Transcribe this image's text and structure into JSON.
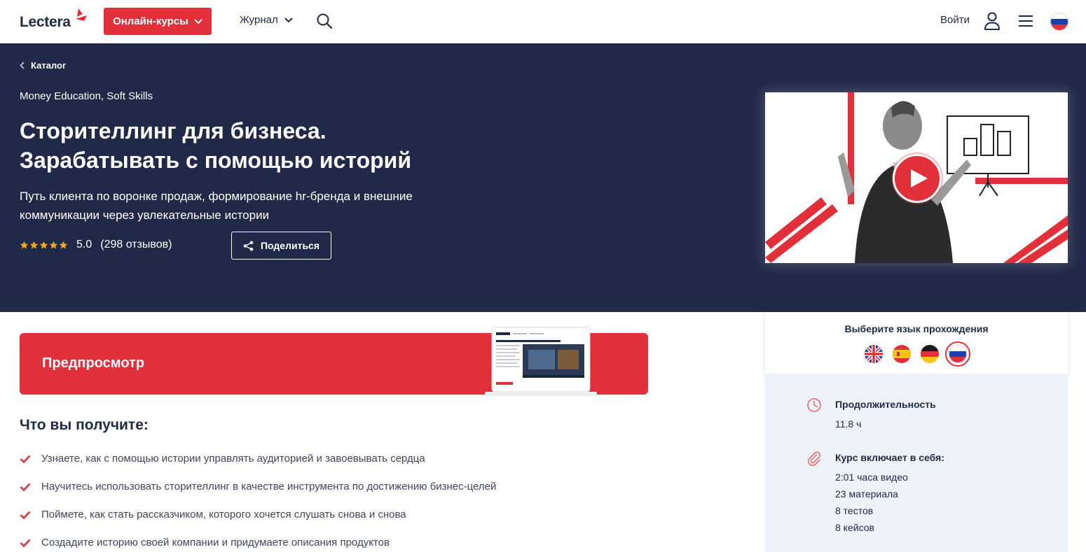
{
  "header": {
    "logo_text": "Lectera",
    "courses_button": "Онлайн-курсы",
    "journal_label": "Журнал",
    "login_label": "Войти"
  },
  "hero": {
    "breadcrumb": "Каталог",
    "categories": "Money Education, Soft Skills",
    "title_line1": "Сторителлинг для бизнеса.",
    "title_line2": "Зарабатывать с помощью историй",
    "subtitle": "Путь клиента по воронке продаж, формирование hr-бренда и внешние коммуникации через увлекательные истории",
    "rating_value": "5.0",
    "rating_stars": 5,
    "rating_count": "(298 отзывов)",
    "share_label": "Поделиться"
  },
  "preview": {
    "title": "Предпросмотр"
  },
  "gains": {
    "title": "Что вы получите:",
    "items": [
      "Узнаете, как с помощью истории управлять аудиторией и завоевывать сердца",
      "Научитесь использовать сторителлинг в качестве инструмента по достижению бизнес-целей",
      "Поймете, как стать рассказчиком, которого хочется слушать снова и снова",
      "Создадите историю своей компании и придумаете описания продуктов"
    ]
  },
  "language": {
    "title": "Выберите язык прохождения",
    "flags": [
      "en",
      "es",
      "de",
      "ru"
    ],
    "selected": "ru"
  },
  "info": {
    "duration_label": "Продолжительность",
    "duration_value": "11.8 ч",
    "includes_label": "Курс включает в себя:",
    "includes": [
      "2:01 часа видео",
      "23 материала",
      "8 тестов",
      "8 кейсов"
    ]
  },
  "colors": {
    "accent": "#e1303a",
    "hero_bg": "#202a48",
    "info_bg": "#edf2f9",
    "star": "#f5a623"
  },
  "icons": {
    "header": [
      "chevron-down-icon",
      "search-icon",
      "user-icon",
      "menu-icon",
      "flag-ru-icon"
    ],
    "share": "share-icon",
    "check": "check-icon",
    "duration": "clock-icon",
    "includes": "paperclip-icon"
  }
}
